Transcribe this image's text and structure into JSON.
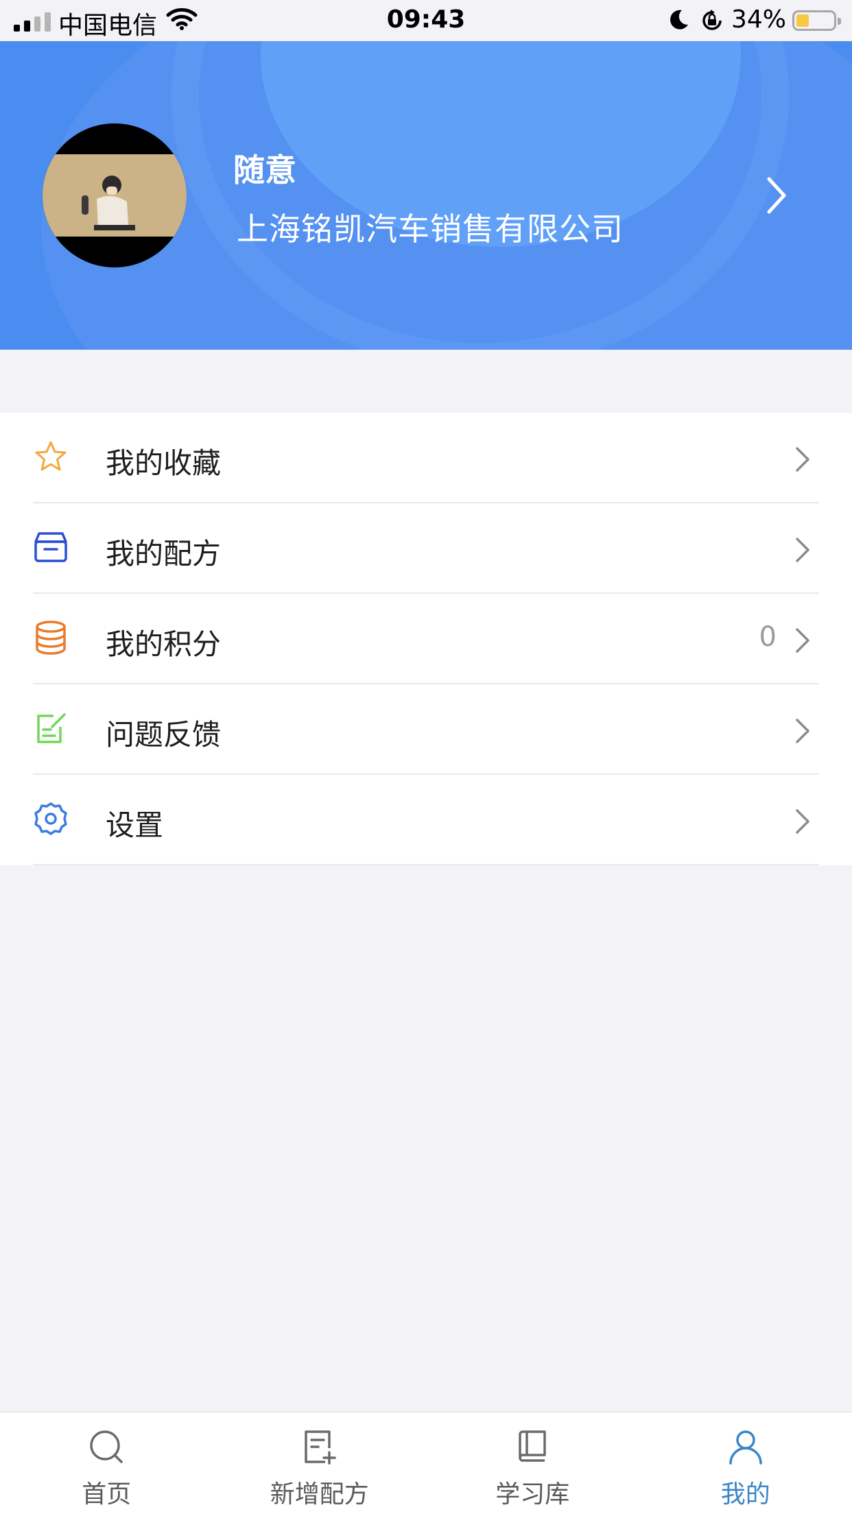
{
  "status_bar": {
    "carrier": "中国电信",
    "time": "09:43",
    "battery_percent": "34%",
    "battery_level": 0.34,
    "icons": [
      "signal-icon",
      "wifi-icon",
      "moon-icon",
      "rotation-lock-icon",
      "battery-icon"
    ]
  },
  "profile": {
    "name": "随意",
    "company": "上海铭凯汽车销售有限公司",
    "header_color": "#4b8cf0"
  },
  "menu": {
    "items": [
      {
        "label": "我的收藏",
        "icon": "star-icon",
        "icon_color": "#f2a93b",
        "value": ""
      },
      {
        "label": "我的配方",
        "icon": "box-icon",
        "icon_color": "#2a4fd6",
        "value": ""
      },
      {
        "label": "我的积分",
        "icon": "database-icon",
        "icon_color": "#e97b2c",
        "value": "0"
      },
      {
        "label": "问题反馈",
        "icon": "edit-note-icon",
        "icon_color": "#6fd85a",
        "value": ""
      },
      {
        "label": "设置",
        "icon": "gear-icon",
        "icon_color": "#3a7de0",
        "value": ""
      }
    ]
  },
  "tab_bar": {
    "tabs": [
      {
        "label": "首页",
        "icon": "search-icon"
      },
      {
        "label": "新增配方",
        "icon": "add-document-icon"
      },
      {
        "label": "学习库",
        "icon": "book-icon"
      },
      {
        "label": "我的",
        "icon": "user-icon",
        "active": true
      }
    ],
    "active_color": "#3a86c8"
  }
}
